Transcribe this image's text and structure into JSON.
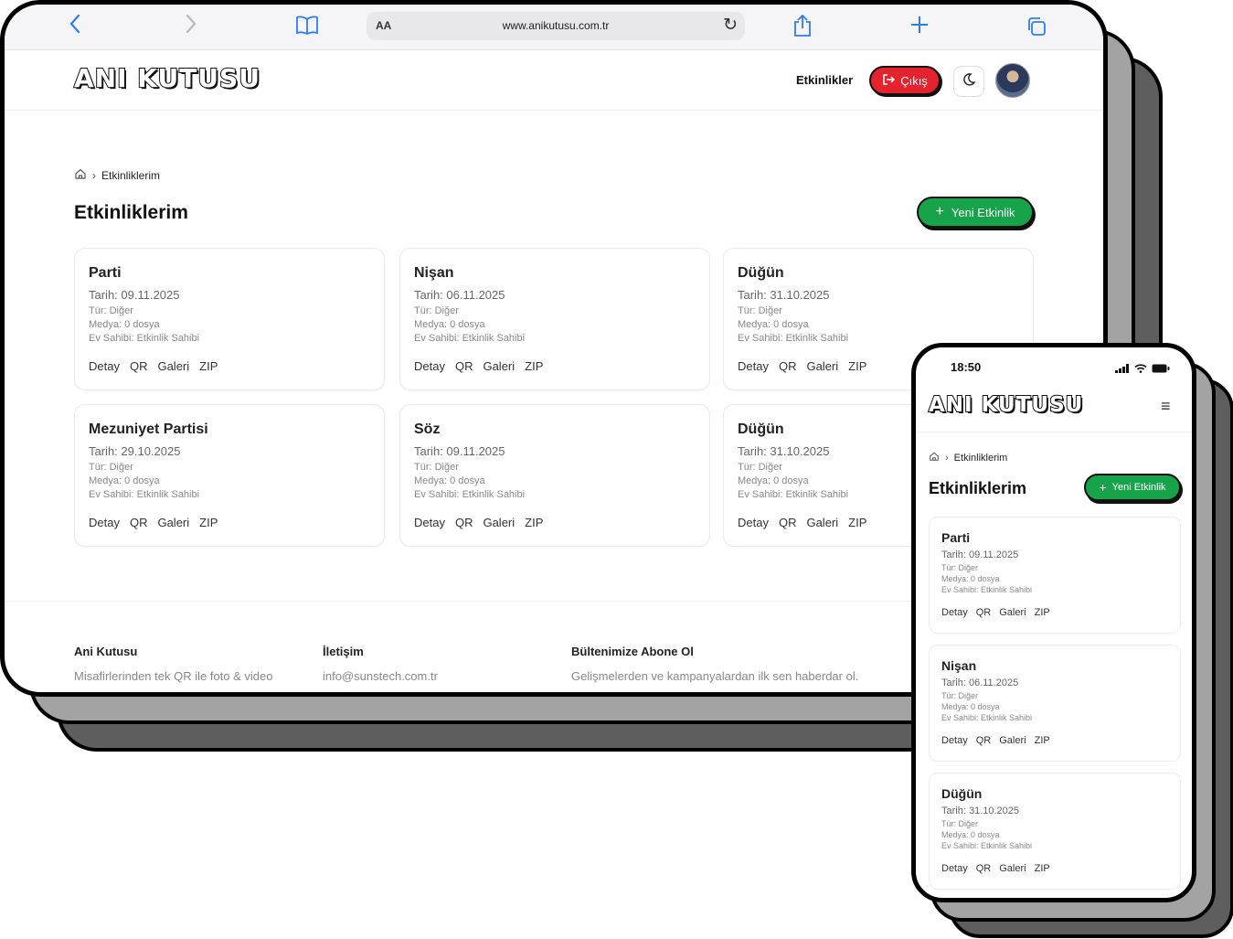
{
  "browser": {
    "url": "www.anikutusu.com.tr",
    "aa": "AA"
  },
  "site": {
    "logo": "ANI KUTUSU",
    "nav_events": "Etkinlikler",
    "logout": "Çıkış"
  },
  "breadcrumb": {
    "current": "Etkinliklerim"
  },
  "page_title": "Etkinliklerim",
  "new_event": "Yeni Etkinlik",
  "actions": {
    "detail": "Detay",
    "qr": "QR",
    "gallery": "Galeri",
    "zip": "ZIP"
  },
  "events": [
    {
      "name": "Parti",
      "date": "Tarih: 09.11.2025",
      "type": "Tür: Diğer",
      "media": "Medya: 0 dosya",
      "host": "Ev Sahibi: Etkinlik Sahibi"
    },
    {
      "name": "Nişan",
      "date": "Tarih: 06.11.2025",
      "type": "Tür: Diğer",
      "media": "Medya: 0 dosya",
      "host": "Ev Sahibi: Etkinlik Sahibi"
    },
    {
      "name": "Düğün",
      "date": "Tarih: 31.10.2025",
      "type": "Tür: Diğer",
      "media": "Medya: 0 dosya",
      "host": "Ev Sahibi: Etkinlik Sahibi"
    },
    {
      "name": "Mezuniyet Partisi",
      "date": "Tarih: 29.10.2025",
      "type": "Tür: Diğer",
      "media": "Medya: 0 dosya",
      "host": "Ev Sahibi: Etkinlik Sahibi"
    },
    {
      "name": "Söz",
      "date": "Tarih: 09.11.2025",
      "type": "Tür: Diğer",
      "media": "Medya: 0 dosya",
      "host": "Ev Sahibi: Etkinlik Sahibi"
    },
    {
      "name": "Düğün",
      "date": "Tarih: 31.10.2025",
      "type": "Tür: Diğer",
      "media": "Medya: 0 dosya",
      "host": "Ev Sahibi: Etkinlik Sahibi"
    }
  ],
  "footer": {
    "col1_title": "Ani Kutusu",
    "col1_text": "Misafirlerinden tek QR ile foto & video",
    "col2_title": "İletişim",
    "col2_text": "info@sunstech.com.tr",
    "col3_title": "Bültenimize Abone Ol",
    "col3_text": "Gelişmelerden ve kampanyalardan ilk sen haberdar ol."
  },
  "phone": {
    "time": "18:50"
  },
  "colors": {
    "accent_green": "#16a34a",
    "logout_red": "#e4232f",
    "safari_blue": "#2f7bf6"
  },
  "icons": [
    "back-icon",
    "forward-icon",
    "book-icon",
    "reload-icon",
    "share-icon",
    "plus-icon",
    "tabs-icon",
    "logout-icon",
    "moon-icon",
    "home-icon",
    "chevron-right-icon",
    "menu-icon",
    "signal-icon",
    "wifi-icon",
    "battery-icon"
  ]
}
